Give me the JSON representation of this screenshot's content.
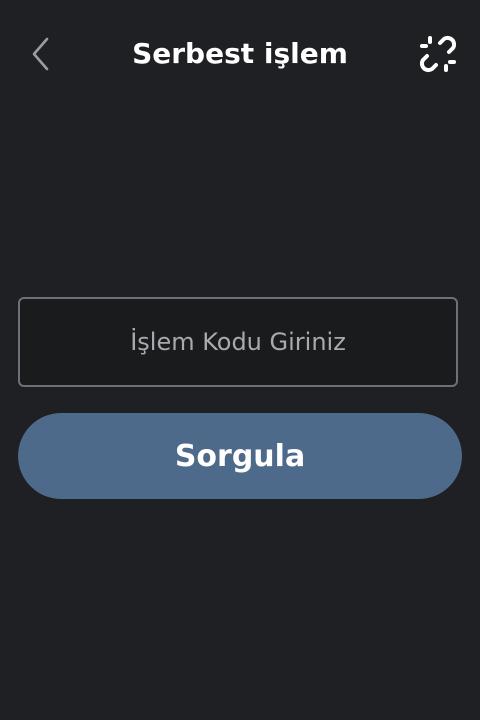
{
  "header": {
    "title": "Serbest işlem",
    "back_icon": "chevron-left-icon",
    "link_icon": "broken-link-icon"
  },
  "form": {
    "code_placeholder": "İşlem Kodu Giriniz",
    "code_value": "",
    "submit_label": "Sorgula"
  },
  "colors": {
    "background": "#1e2024",
    "button": "#4e6a8b",
    "field_border": "#6d7177",
    "text": "#ffffff",
    "placeholder": "#a7aaae"
  }
}
